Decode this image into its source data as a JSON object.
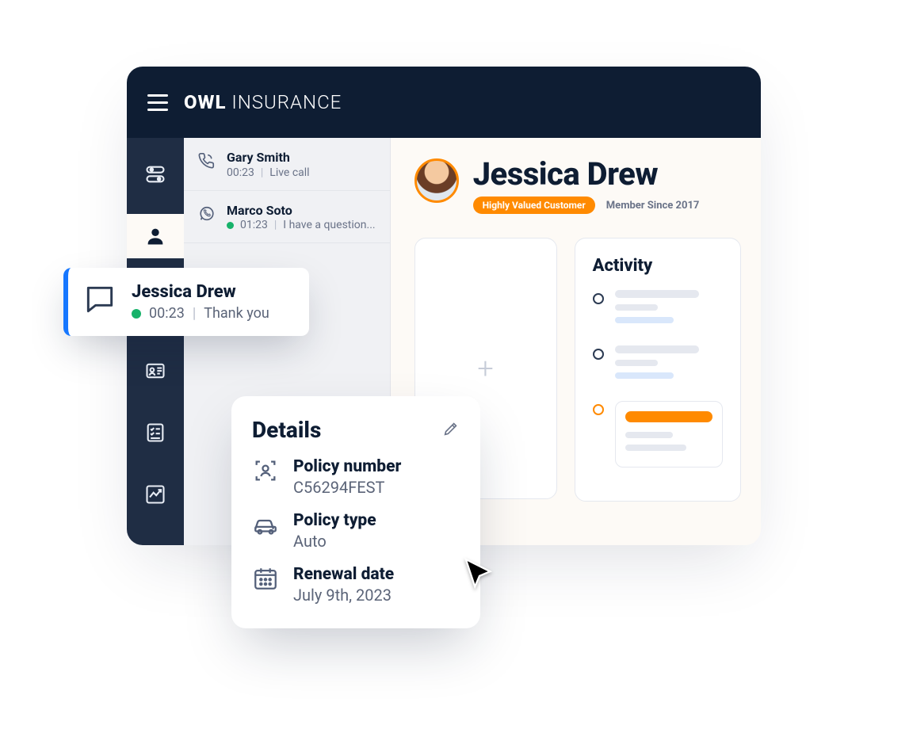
{
  "brand": {
    "bold": "OWL",
    "rest": " INSURANCE"
  },
  "conversations": [
    {
      "name": "Gary Smith",
      "time": "00:23",
      "status": "Live call",
      "dot": false
    },
    {
      "name": "Marco Soto",
      "time": "01:23",
      "status": "I have a question...",
      "dot": true
    }
  ],
  "selected_conversation": {
    "name": "Jessica Drew",
    "time": "00:23",
    "status": "Thank you"
  },
  "profile": {
    "name": "Jessica Drew",
    "badge": "Highly Valued Customer",
    "member": "Member Since 2017"
  },
  "activity": {
    "title": "Activity"
  },
  "add_panel": {
    "glyph": "+"
  },
  "details": {
    "title": "Details",
    "rows": [
      {
        "label": "Policy number",
        "value": "C56294FEST"
      },
      {
        "label": "Policy type",
        "value": "Auto"
      },
      {
        "label": "Renewal date",
        "value": "July 9th, 2023"
      }
    ]
  }
}
